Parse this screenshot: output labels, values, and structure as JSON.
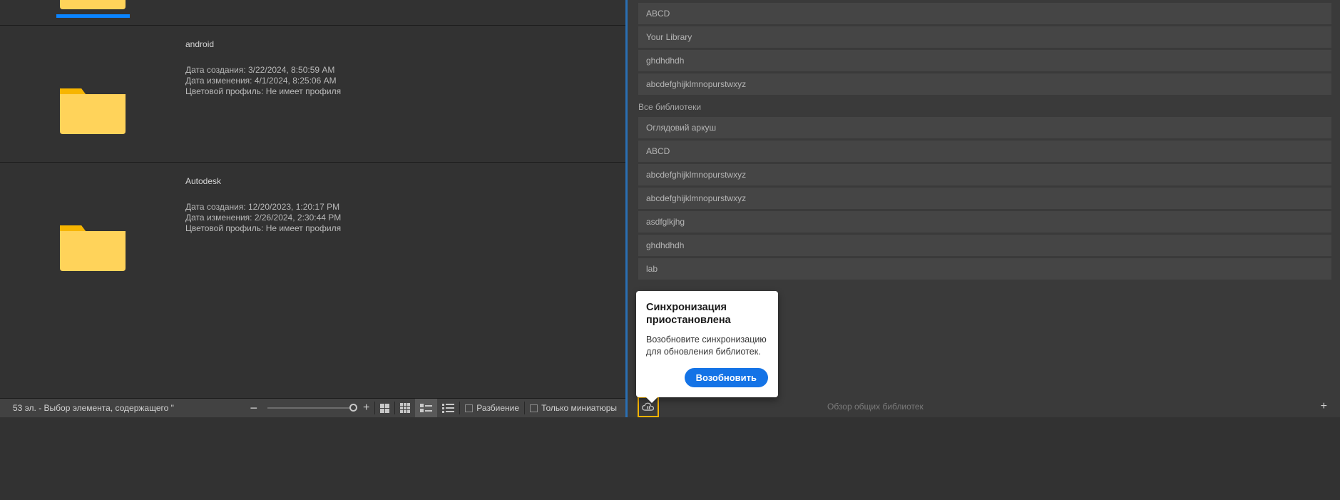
{
  "folders": [
    {
      "name": "",
      "created": "",
      "modified": "",
      "profile": "",
      "selected": true
    },
    {
      "name": "android",
      "created_label": "Дата создания:",
      "created": "3/22/2024, 8:50:59 AM",
      "modified_label": "Дата изменения:",
      "modified": "4/1/2024, 8:25:06 AM",
      "profile_label": "Цветовой профиль:",
      "profile": "Не имеет профиля"
    },
    {
      "name": "Autodesk",
      "created_label": "Дата создания:",
      "created": "12/20/2023, 1:20:17 PM",
      "modified_label": "Дата изменения:",
      "modified": "2/26/2024, 2:30:44 PM",
      "profile_label": "Цветовой профиль:",
      "profile": "Не имеет профиля"
    }
  ],
  "statusbar": {
    "text": "53 эл. - Выбор элемента, содержащего \"",
    "breakup": "Разбиение",
    "thumbsOnly": "Только миниатюры"
  },
  "libraries": {
    "recent": [
      {
        "label": "ABCD"
      },
      {
        "label": "Your Library"
      },
      {
        "label": "ghdhdhdh"
      },
      {
        "label": "abcdefghijklmnopurstwxyz"
      }
    ],
    "allSection": "Все библиотеки",
    "all": [
      {
        "label": "Оглядовий аркуш"
      },
      {
        "label": "ABCD"
      },
      {
        "label": "abcdefghijklmnopurstwxyz"
      },
      {
        "label": "abcdefghijklmnopurstwxyz"
      },
      {
        "label": "asdfglkjhg"
      },
      {
        "label": "ghdhdhdh"
      },
      {
        "label": "lab"
      }
    ],
    "sharedLabel": "Обзор общих библиотек"
  },
  "tooltip": {
    "title": "Синхронизация приостановлена",
    "body": "Возобновите синхронизацию для обновления библиотек.",
    "button": "Возобновить"
  }
}
